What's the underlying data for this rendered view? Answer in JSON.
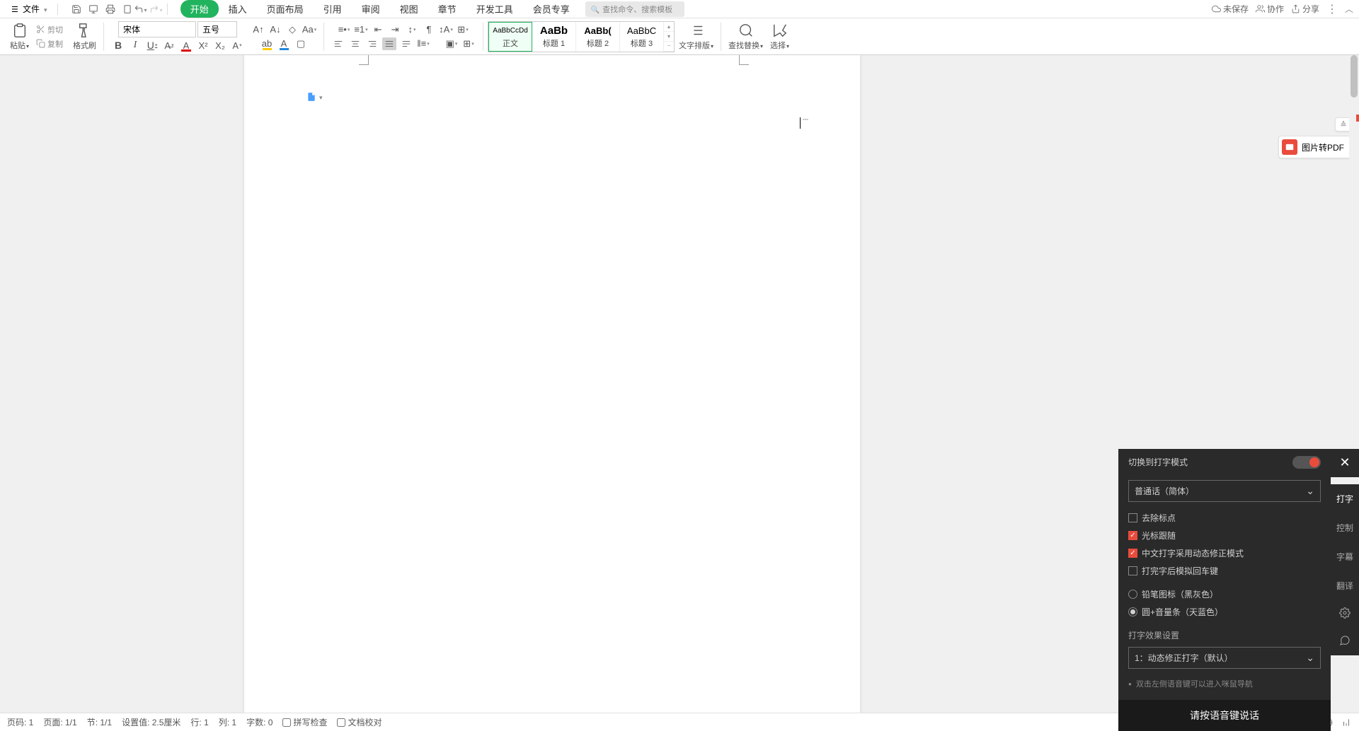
{
  "menu": {
    "file": "文件",
    "tabs": [
      "开始",
      "插入",
      "页面布局",
      "引用",
      "审阅",
      "视图",
      "章节",
      "开发工具",
      "会员专享"
    ],
    "search_placeholder": "查找命令、搜索模板",
    "right": {
      "unsaved": "未保存",
      "collab": "协作",
      "share": "分享"
    }
  },
  "ribbon": {
    "paste": "粘贴",
    "cut": "剪切",
    "copy": "复制",
    "painter": "格式刷",
    "font_name": "宋体",
    "font_size": "五号",
    "styles": {
      "preview": "AaBbCcDd",
      "preview_bold": "AaBb",
      "preview_h2": "AaBb(",
      "preview_h3": "AaBbC",
      "body": "正文",
      "h1": "标题 1",
      "h2": "标题 2",
      "h3": "标题 3"
    },
    "text_layout": "文字排版",
    "find_replace": "查找替换",
    "select": "选择"
  },
  "side": {
    "pdf": "图片转PDF"
  },
  "status": {
    "page_num": "页码: 1",
    "page": "页面: 1/1",
    "section": "节: 1/1",
    "position": "设置值: 2.5厘米",
    "line": "行: 1",
    "col": "列: 1",
    "words": "字数: 0",
    "spell": "拼写检查",
    "proof": "文档校对"
  },
  "voice": {
    "title": "切换到打字模式",
    "lang": "普通话（简体）",
    "checks": {
      "c1": "去除标点",
      "c2": "光标跟随",
      "c3": "中文打字采用动态修正模式",
      "c4": "打完字后模拟回车键"
    },
    "radios": {
      "r1": "铅笔图标（黑灰色）",
      "r2": "圆+音量条（天蓝色）"
    },
    "effect_label": "打字效果设置",
    "effect_value": "1：动态修正打字（默认）",
    "hint": "双击左侧语音键可以进入咪鼠导航",
    "footer": "请按语音键说话",
    "tabs": {
      "t1": "打字",
      "t2": "控制",
      "t3": "字幕",
      "t4": "翻译"
    }
  }
}
